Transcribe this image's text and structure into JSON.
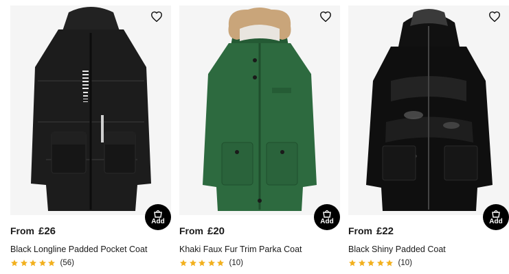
{
  "products": [
    {
      "price_prefix": "From",
      "price": "£26",
      "title": "Black Longline Padded Pocket Coat",
      "rating": 5,
      "review_count": "(56)",
      "add_label": "Add",
      "colors": {
        "coat": "#1c1c1c",
        "background": "#f5f5f5"
      }
    },
    {
      "price_prefix": "From",
      "price": "£20",
      "title": "Khaki Faux Fur Trim Parka Coat",
      "rating": 5,
      "review_count": "(10)",
      "add_label": "Add",
      "colors": {
        "coat": "#2d6a3f",
        "fur": "#c9a57a",
        "background": "#f5f5f5"
      }
    },
    {
      "price_prefix": "From",
      "price": "£22",
      "title": "Black Shiny Padded Coat",
      "rating": 5,
      "review_count": "(10)",
      "add_label": "Add",
      "colors": {
        "coat": "#0f0f0f",
        "background": "#f5f5f5"
      }
    }
  ],
  "star_color": "#f2b01e",
  "icons": {
    "wishlist": "heart-outline-icon",
    "add": "shopping-bag-icon",
    "rating": "star-icon"
  }
}
